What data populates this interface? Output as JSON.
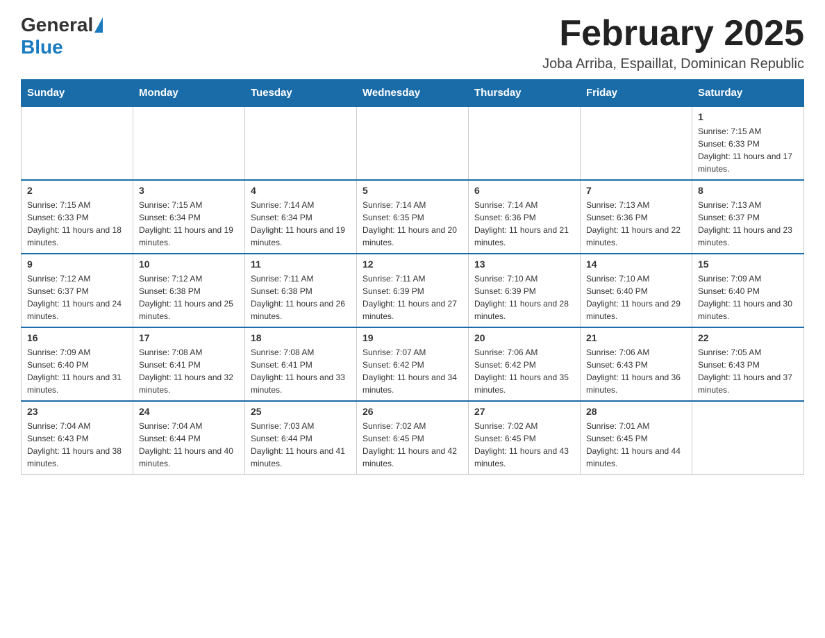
{
  "logo": {
    "general": "General",
    "blue": "Blue"
  },
  "header": {
    "title": "February 2025",
    "location": "Joba Arriba, Espaillat, Dominican Republic"
  },
  "weekdays": [
    "Sunday",
    "Monday",
    "Tuesday",
    "Wednesday",
    "Thursday",
    "Friday",
    "Saturday"
  ],
  "weeks": [
    [
      {
        "day": "",
        "info": ""
      },
      {
        "day": "",
        "info": ""
      },
      {
        "day": "",
        "info": ""
      },
      {
        "day": "",
        "info": ""
      },
      {
        "day": "",
        "info": ""
      },
      {
        "day": "",
        "info": ""
      },
      {
        "day": "1",
        "info": "Sunrise: 7:15 AM\nSunset: 6:33 PM\nDaylight: 11 hours and 17 minutes."
      }
    ],
    [
      {
        "day": "2",
        "info": "Sunrise: 7:15 AM\nSunset: 6:33 PM\nDaylight: 11 hours and 18 minutes."
      },
      {
        "day": "3",
        "info": "Sunrise: 7:15 AM\nSunset: 6:34 PM\nDaylight: 11 hours and 19 minutes."
      },
      {
        "day": "4",
        "info": "Sunrise: 7:14 AM\nSunset: 6:34 PM\nDaylight: 11 hours and 19 minutes."
      },
      {
        "day": "5",
        "info": "Sunrise: 7:14 AM\nSunset: 6:35 PM\nDaylight: 11 hours and 20 minutes."
      },
      {
        "day": "6",
        "info": "Sunrise: 7:14 AM\nSunset: 6:36 PM\nDaylight: 11 hours and 21 minutes."
      },
      {
        "day": "7",
        "info": "Sunrise: 7:13 AM\nSunset: 6:36 PM\nDaylight: 11 hours and 22 minutes."
      },
      {
        "day": "8",
        "info": "Sunrise: 7:13 AM\nSunset: 6:37 PM\nDaylight: 11 hours and 23 minutes."
      }
    ],
    [
      {
        "day": "9",
        "info": "Sunrise: 7:12 AM\nSunset: 6:37 PM\nDaylight: 11 hours and 24 minutes."
      },
      {
        "day": "10",
        "info": "Sunrise: 7:12 AM\nSunset: 6:38 PM\nDaylight: 11 hours and 25 minutes."
      },
      {
        "day": "11",
        "info": "Sunrise: 7:11 AM\nSunset: 6:38 PM\nDaylight: 11 hours and 26 minutes."
      },
      {
        "day": "12",
        "info": "Sunrise: 7:11 AM\nSunset: 6:39 PM\nDaylight: 11 hours and 27 minutes."
      },
      {
        "day": "13",
        "info": "Sunrise: 7:10 AM\nSunset: 6:39 PM\nDaylight: 11 hours and 28 minutes."
      },
      {
        "day": "14",
        "info": "Sunrise: 7:10 AM\nSunset: 6:40 PM\nDaylight: 11 hours and 29 minutes."
      },
      {
        "day": "15",
        "info": "Sunrise: 7:09 AM\nSunset: 6:40 PM\nDaylight: 11 hours and 30 minutes."
      }
    ],
    [
      {
        "day": "16",
        "info": "Sunrise: 7:09 AM\nSunset: 6:40 PM\nDaylight: 11 hours and 31 minutes."
      },
      {
        "day": "17",
        "info": "Sunrise: 7:08 AM\nSunset: 6:41 PM\nDaylight: 11 hours and 32 minutes."
      },
      {
        "day": "18",
        "info": "Sunrise: 7:08 AM\nSunset: 6:41 PM\nDaylight: 11 hours and 33 minutes."
      },
      {
        "day": "19",
        "info": "Sunrise: 7:07 AM\nSunset: 6:42 PM\nDaylight: 11 hours and 34 minutes."
      },
      {
        "day": "20",
        "info": "Sunrise: 7:06 AM\nSunset: 6:42 PM\nDaylight: 11 hours and 35 minutes."
      },
      {
        "day": "21",
        "info": "Sunrise: 7:06 AM\nSunset: 6:43 PM\nDaylight: 11 hours and 36 minutes."
      },
      {
        "day": "22",
        "info": "Sunrise: 7:05 AM\nSunset: 6:43 PM\nDaylight: 11 hours and 37 minutes."
      }
    ],
    [
      {
        "day": "23",
        "info": "Sunrise: 7:04 AM\nSunset: 6:43 PM\nDaylight: 11 hours and 38 minutes."
      },
      {
        "day": "24",
        "info": "Sunrise: 7:04 AM\nSunset: 6:44 PM\nDaylight: 11 hours and 40 minutes."
      },
      {
        "day": "25",
        "info": "Sunrise: 7:03 AM\nSunset: 6:44 PM\nDaylight: 11 hours and 41 minutes."
      },
      {
        "day": "26",
        "info": "Sunrise: 7:02 AM\nSunset: 6:45 PM\nDaylight: 11 hours and 42 minutes."
      },
      {
        "day": "27",
        "info": "Sunrise: 7:02 AM\nSunset: 6:45 PM\nDaylight: 11 hours and 43 minutes."
      },
      {
        "day": "28",
        "info": "Sunrise: 7:01 AM\nSunset: 6:45 PM\nDaylight: 11 hours and 44 minutes."
      },
      {
        "day": "",
        "info": ""
      }
    ]
  ]
}
